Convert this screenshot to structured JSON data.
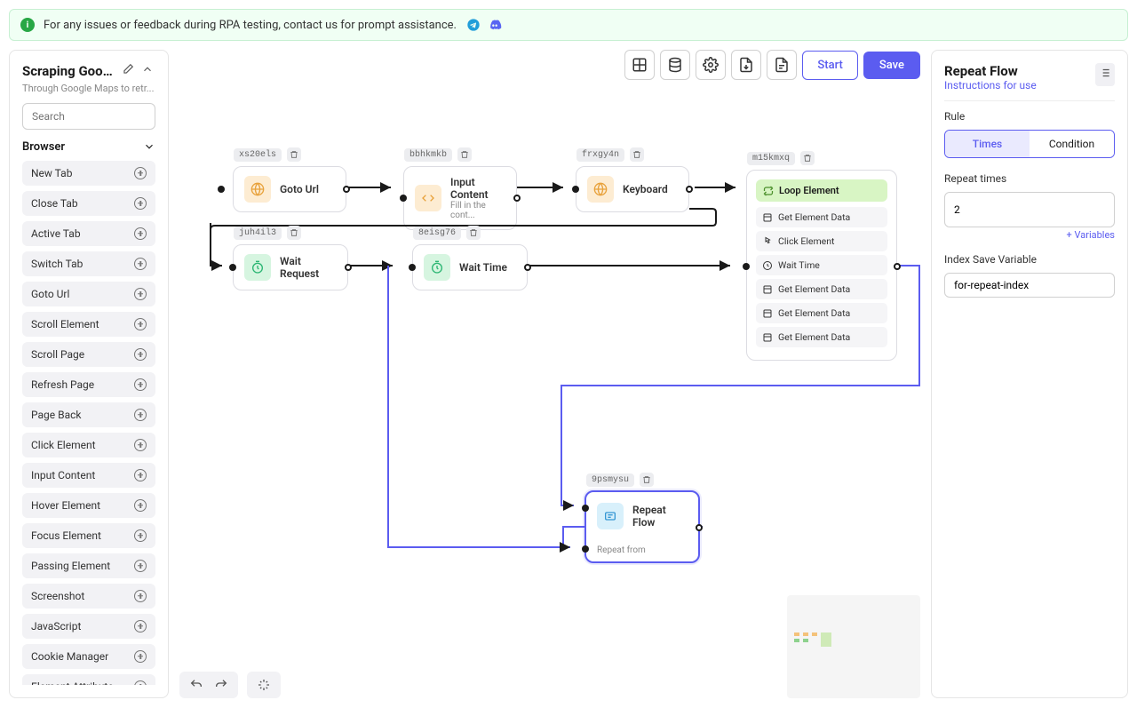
{
  "banner": {
    "text": "For any issues or feedback during RPA testing, contact us for prompt assistance."
  },
  "sidebar": {
    "title": "Scraping Google...",
    "subtitle": "Through Google Maps to retr...",
    "search_placeholder": "Search",
    "group": "Browser",
    "items": [
      "New Tab",
      "Close Tab",
      "Active Tab",
      "Switch Tab",
      "Goto Url",
      "Scroll Element",
      "Scroll Page",
      "Refresh Page",
      "Page Back",
      "Click Element",
      "Input Content",
      "Hover Element",
      "Focus Element",
      "Passing Element",
      "Screenshot",
      "JavaScript",
      "Cookie Manager",
      "Element Attribute"
    ]
  },
  "toolbar": {
    "start": "Start",
    "save": "Save"
  },
  "nodes": {
    "n1": {
      "id": "xs20els",
      "label": "Goto Url"
    },
    "n2": {
      "id": "bbhkmkb",
      "label": "Input Content",
      "sub": "Fill in the cont..."
    },
    "n3": {
      "id": "frxgy4n",
      "label": "Keyboard"
    },
    "n4": {
      "id": "juh4il3",
      "label": "Wait Request"
    },
    "n5": {
      "id": "8eisg76",
      "label": "Wait Time"
    },
    "loop": {
      "id": "m15kmxq",
      "head": "Loop Element",
      "items": [
        "Get Element Data",
        "Click Element",
        "Wait Time",
        "Get Element Data",
        "Get Element Data",
        "Get Element Data"
      ]
    },
    "repeat": {
      "id": "9psmysu",
      "label": "Repeat Flow",
      "sub": "Repeat from"
    }
  },
  "right": {
    "title": "Repeat Flow",
    "link": "Instructions for use",
    "ruleLabel": "Rule",
    "seg1": "Times",
    "seg2": "Condition",
    "timesLabel": "Repeat times",
    "timesValue": "2",
    "varsLink": "+ Variables",
    "indexLabel": "Index Save Variable",
    "indexValue": "for-repeat-index"
  }
}
